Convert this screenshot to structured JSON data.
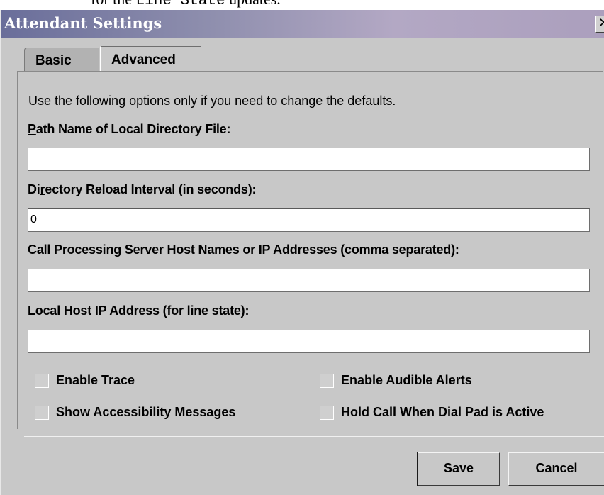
{
  "background_text": {
    "prefix": "for the ",
    "code": "Line State",
    "suffix": " updates."
  },
  "window": {
    "title": "Attendant Settings",
    "close_glyph": "✕"
  },
  "tabs": [
    {
      "label": "Basic",
      "selected": true
    },
    {
      "label": "Advanced",
      "selected": false
    }
  ],
  "intro_text": "Use the following options only if you need to change the defaults.",
  "fields": {
    "directory_file": {
      "mnemonic": "P",
      "label_rest": "ath Name of Local Directory File:",
      "value": ""
    },
    "reload_interval": {
      "label_pre": "Di",
      "mnemonic": "r",
      "label_rest": "ectory Reload Interval (in seconds):",
      "value": "0"
    },
    "server_hosts": {
      "mnemonic": "C",
      "label_rest": "all Processing Server Host Names or IP Addresses (comma separated):",
      "value": ""
    },
    "local_host_ip": {
      "mnemonic": "L",
      "label_rest": "ocal Host IP Address (for line state):",
      "value": ""
    }
  },
  "checkboxes": {
    "enable_trace": {
      "label": "Enable Trace",
      "checked": false
    },
    "enable_audible_alerts": {
      "label": "Enable Audible Alerts",
      "checked": false
    },
    "show_accessibility_messages": {
      "label": "Show Accessibility Messages",
      "checked": false
    },
    "hold_call_dial_pad": {
      "label": "Hold Call When Dial Pad is Active",
      "checked": false
    }
  },
  "buttons": {
    "save": "Save",
    "cancel": "Cancel"
  }
}
